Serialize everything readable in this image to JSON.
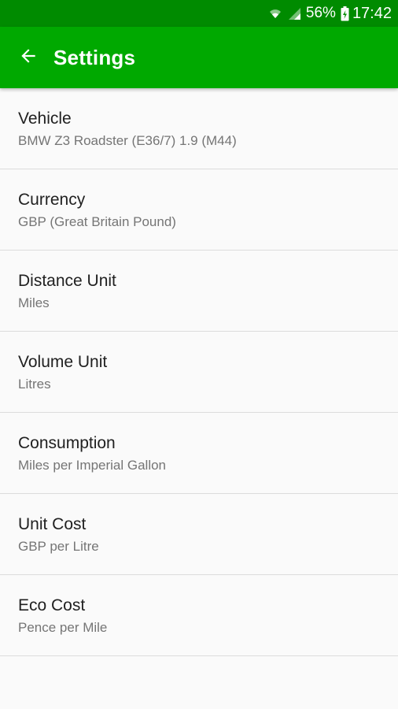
{
  "status_bar": {
    "battery_percent": "56%",
    "time": "17:42",
    "icons": [
      "wifi-icon",
      "signal-icon",
      "battery-charging-icon"
    ]
  },
  "app_bar": {
    "title": "Settings",
    "back_icon": "arrow-back-icon",
    "background_color": "#00a900"
  },
  "settings": {
    "items": [
      {
        "title": "Vehicle",
        "subtitle": "BMW Z3 Roadster (E36/7) 1.9 (M44)"
      },
      {
        "title": "Currency",
        "subtitle": "GBP (Great Britain Pound)"
      },
      {
        "title": "Distance Unit",
        "subtitle": "Miles"
      },
      {
        "title": "Volume Unit",
        "subtitle": "Litres"
      },
      {
        "title": "Consumption",
        "subtitle": "Miles per Imperial Gallon"
      },
      {
        "title": "Unit Cost",
        "subtitle": "GBP per Litre"
      },
      {
        "title": "Eco Cost",
        "subtitle": "Pence per Mile"
      }
    ]
  }
}
